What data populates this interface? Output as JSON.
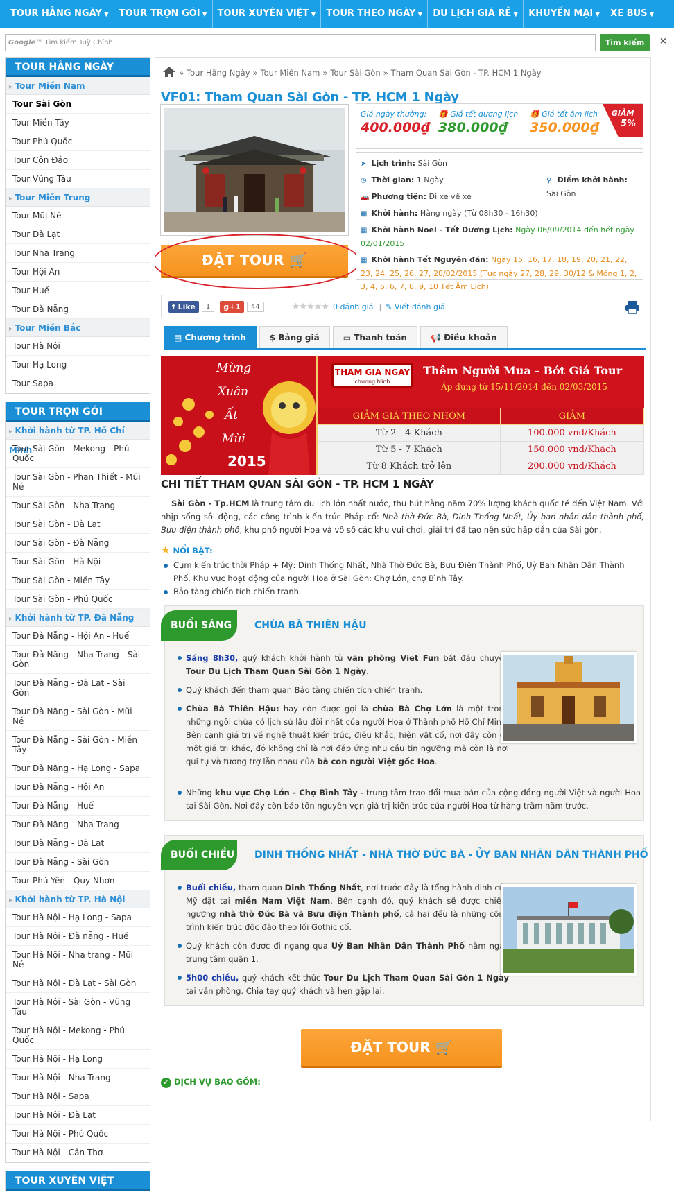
{
  "nav": {
    "items": [
      "TOUR HẰNG NGÀY",
      "TOUR TRỌN GÓI",
      "TOUR XUYÊN VIỆT",
      "TOUR THEO NGÀY",
      "DU LỊCH GIÁ RẺ",
      "KHUYẾN MẠI",
      "XE BUS"
    ],
    "bg_color": "#1aa0e6"
  },
  "search": {
    "google_text": "Google™",
    "placeholder": "Tìm kiếm Tuỳ Chỉnh",
    "button": "Tìm kiếm",
    "close": "×"
  },
  "sidebar": {
    "blocks": [
      {
        "title": "TOUR HẰNG NGÀY",
        "groups": [
          {
            "name": "Tour Miền Nam",
            "links": [
              "Tour Sài Gòn",
              "Tour Miền Tây",
              "Tour Phú Quốc",
              "Tour Côn Đảo",
              "Tour Vũng Tàu"
            ]
          },
          {
            "name": "Tour Miền Trung",
            "links": [
              "Tour Mũi Né",
              "Tour Đà Lạt",
              "Tour Nha Trang",
              "Tour Hội An",
              "Tour Huế",
              "Tour Đà Nẵng"
            ]
          },
          {
            "name": "Tour Miền Bắc",
            "links": [
              "Tour Hà Nội",
              "Tour Hạ Long",
              "Tour Sapa"
            ]
          }
        ]
      },
      {
        "title": "TOUR TRỌN GÓI",
        "groups": [
          {
            "name": "Khởi hành từ TP. Hồ Chí Minh",
            "links": [
              "Tour Sài Gòn - Mekong - Phú Quốc",
              "Tour Sài Gòn - Phan Thiết - Mũi Né",
              "Tour Sài Gòn - Nha Trang",
              "Tour Sài Gòn - Đà Lạt",
              "Tour Sài Gòn - Đà Nẵng",
              "Tour Sài Gòn - Hà Nội",
              "Tour Sài Gòn - Miền Tây",
              "Tour Sài Gòn - Phú Quốc"
            ]
          },
          {
            "name": "Khởi hành từ TP. Đà Nẵng",
            "links": [
              "Tour Đà Nẵng - Hội An - Huế",
              "Tour Đà Nẵng - Nha Trang - Sài Gòn",
              "Tour Đà Nẵng - Đà Lạt - Sài Gòn",
              "Tour Đà Nẵng - Sài Gòn - Mũi Né",
              "Tour Đà Nẵng - Sài Gòn - Miền Tây",
              "Tour Đà Nẵng - Hạ Long - Sapa",
              "Tour Đà Nẵng - Hội An",
              "Tour Đà Nẵng - Huế",
              "Tour Đà Nẵng - Nha Trang",
              "Tour Đà Nẵng - Đà Lạt",
              "Tour Đà Nẵng - Sài Gòn",
              "Tour Phú Yên - Quy Nhơn"
            ]
          },
          {
            "name": "Khởi hành từ TP. Hà Nội",
            "links": [
              "Tour Hà Nội - Hạ Long - Sapa",
              "Tour Hà Nội - Đà nẵng - Huế",
              "Tour Hà Nội - Nha trang - Mũi Né",
              "Tour Hà Nội - Đà Lạt - Sài Gòn",
              "Tour Hà Nội - Sài Gòn - Vũng Tàu",
              "Tour Hà Nội - Mekong - Phú Quốc",
              "Tour Hà Nội - Hạ Long",
              "Tour Hà Nội - Nha Trang",
              "Tour Hà Nội - Sapa",
              "Tour Hà Nội - Đà Lạt",
              "Tour Hà Nội - Phú Quốc",
              "Tour Hà Nội - Cần Thơ"
            ]
          }
        ]
      },
      {
        "title": "TOUR XUYÊN VIỆT",
        "groups": []
      }
    ]
  },
  "breadcrumb": [
    "Tour Hằng Ngày",
    "Tour Miền Nam",
    "Tour Sài Gòn",
    "Tham Quan Sài Gòn - TP. HCM 1 Ngày"
  ],
  "tour": {
    "title": "VF01: Tham Quan Sài Gòn - TP. HCM 1 Ngày",
    "order_label": "ĐẶT TOUR",
    "prices": [
      {
        "label": "Giá ngày thường:",
        "value": "400.000₫",
        "color": "#d9222a"
      },
      {
        "label": "Giá tết dương lịch",
        "value": "380.000₫",
        "color": "#2e9a2e"
      },
      {
        "label": "Giá tết âm lịch",
        "value": "350.000₫",
        "color": "#f7931e"
      }
    ],
    "sale_top": "GIẢM",
    "sale_pct": "5%",
    "info": {
      "schedule_label": "Lịch trình:",
      "schedule": "Sài Gòn",
      "time_label": "Thời gian:",
      "time": "1 Ngày",
      "start_point_label": "Điểm khởi hành:",
      "start_point": "Sài Gòn",
      "vehicle_label": "Phương tiện:",
      "vehicle": "Đi xe về xe",
      "depart_label": "Khởi hành:",
      "depart": "Hàng ngày (Từ 08h30 - 16h30)",
      "noel_label": "Khởi hành Noel - Tết Dương Lịch:",
      "noel": "Ngày 06/09/2014 đến hết ngày 02/01/2015",
      "lunar_label": "Khởi hành Tết Nguyên đán:",
      "lunar": "Ngày 15, 16, 17, 18, 19, 20, 21, 22, 23, 24, 25, 26, 27, 28/02/2015 (Tức ngày 27, 28, 29, 30/12 & Mồng 1, 2, 3, 4, 5, 6, 7, 8, 9, 10 Tết Âm Lịch)"
    }
  },
  "social": {
    "like": "Like",
    "like_count": "1",
    "gplus": "g+1",
    "gplus_count": "44",
    "stars": "★★★★★",
    "rating_count": "0 đánh giá",
    "write_review": "Viết đánh giá"
  },
  "tabs": [
    "Chương trình",
    "$ Bảng giá",
    "Thanh toán",
    "Điều khoản"
  ],
  "banner": {
    "vertical_words": [
      "Mừng",
      "Xuân",
      "Ất",
      "Mùi"
    ],
    "year": "2015",
    "join_title": "THAM GIA NGAY",
    "join_sub": "chương trình",
    "title": "Thêm Người Mua - Bớt Giá Tour",
    "subtitle": "Áp dụng từ 15/11/2014 đến 02/03/2015",
    "table_headers": [
      "GIẢM GIÁ THEO NHÓM",
      "GIẢM"
    ],
    "rows": [
      {
        "group": "Từ 2 - 4 Khách",
        "discount": "100.000 vnd/Khách"
      },
      {
        "group": "Từ 5 - 7 Khách",
        "discount": "150.000 vnd/Khách"
      },
      {
        "group": "Từ 8 Khách trở lên",
        "discount": "200.000 vnd/Khách"
      }
    ]
  },
  "detail": {
    "title": "CHI TIẾT THAM QUAN SÀI GÒN - TP. HCM 1 NGÀY",
    "intro_bold": "Sài Gòn - Tp.HCM",
    "intro_1": " là trung tâm du lịch lớn nhất nước, thu hút hằng năm 70% lượng khách quốc tế đến Việt Nam. Với nhịp sống sôi động, các công trình kiến trúc Pháp cổ: ",
    "intro_italic": "Nhà thờ Đức Bà, Dinh Thống Nhất, Ủy ban nhân dân thành phố, Bưu điện thành phố",
    "intro_2": ", khu phố người Hoa và vô số các khu vui chơi, giải trí đã tạo nên sức hấp dẫn của Sài gòn.",
    "highlight_title": "NỔI BẬT:",
    "highlights": [
      "Cụm kiến trúc thời Pháp + Mỹ: Dinh Thống Nhất, Nhà Thờ Đức Bà, Bưu Điện Thành Phố, Uỷ Ban Nhân Dân Thành Phố. Khu vực hoạt động của người Hoa ở Sài Gòn: Chợ Lớn, chợ Bình Tây.",
      "Bảo tàng chiến tích chiến tranh."
    ]
  },
  "morning": {
    "tag": "BUỔI SÁNG",
    "title": "CHÙA BÀ THIÊN HẬU",
    "p1_time": "Sáng 8h30,",
    "p1_a": " quý khách khởi hành từ ",
    "p1_office": "văn phòng Viet Fun",
    "p1_b": " bắt đầu chuyến ",
    "p1_tour": "Tour Du Lịch Tham Quan Sài Gòn 1 Ngày",
    "p1_end": ".",
    "p2": "Quý khách đến tham quan Bảo tàng chiến tích chiến tranh.",
    "p3_bold": "Chùa Bà Thiên Hậu:",
    "p3_a": " hay còn được gọi là ",
    "p3_b": "chùa Bà Chợ Lớn",
    "p3_c": " là một trong những ngôi chùa có lịch sử lâu đời nhất của người Hoa ở Thành phố Hồ Chí Minh. Bên cạnh giá trị về nghệ thuật kiến trúc, điêu khắc, hiện vật cổ, nơi đây còn có một giá trị khác, đó không chỉ là nơi đáp ứng nhu cầu tín ngưỡng mà còn là nơi qui tụ và tương trợ lẫn nhau của ",
    "p3_d": "bà con người Việt gốc Hoa",
    "p3_end": ".",
    "p4_a": "Những ",
    "p4_bold": "khu vực Chợ Lớn - Chợ Bình Tây",
    "p4_b": " - trung tâm trao đổi mua bán của cộng đồng người Việt và người Hoa tại Sài Gòn. Nơi đây còn bảo tồn nguyên vẹn giá trị kiến trúc của người Hoa từ hàng trăm năm trước."
  },
  "afternoon": {
    "tag": "BUỔI CHIỀU",
    "title": "DINH THỐNG NHẤT - NHÀ THỜ ĐỨC BÀ - ỦY BAN NHÂN DÂN THÀNH PHỐ",
    "p1_time": "Buổi chiều,",
    "p1_a": " tham quan ",
    "p1_b": "Dinh Thống Nhất",
    "p1_c": ", nơi trước đây là tổng hành dinh của Mỹ đặt tại ",
    "p1_d": "miền Nam Việt Nam",
    "p1_e": ". Bên cạnh đó, quý khách sẽ được chiêm ngưỡng ",
    "p1_f": "nhà thờ Đức Bà và Bưu điện Thành phố",
    "p1_g": ", cả hai đều là những công trình kiến trúc độc đáo theo lối Gothic cổ.",
    "p2_a": "Quý khách còn được đi ngang qua ",
    "p2_b": "Uỷ Ban Nhân Dân Thành Phố",
    "p2_c": " nằm ngay trung tâm quận 1.",
    "p3_time": "5h00 chiều,",
    "p3_a": " quý khách kết thúc ",
    "p3_b": "Tour Du Lịch Tham Quan Sài Gòn 1 Ngày",
    "p3_c": " tại văn phòng. Chia tay quý khách và hẹn gặp lại."
  },
  "services_title": "DỊCH VỤ BAO GỒM:"
}
